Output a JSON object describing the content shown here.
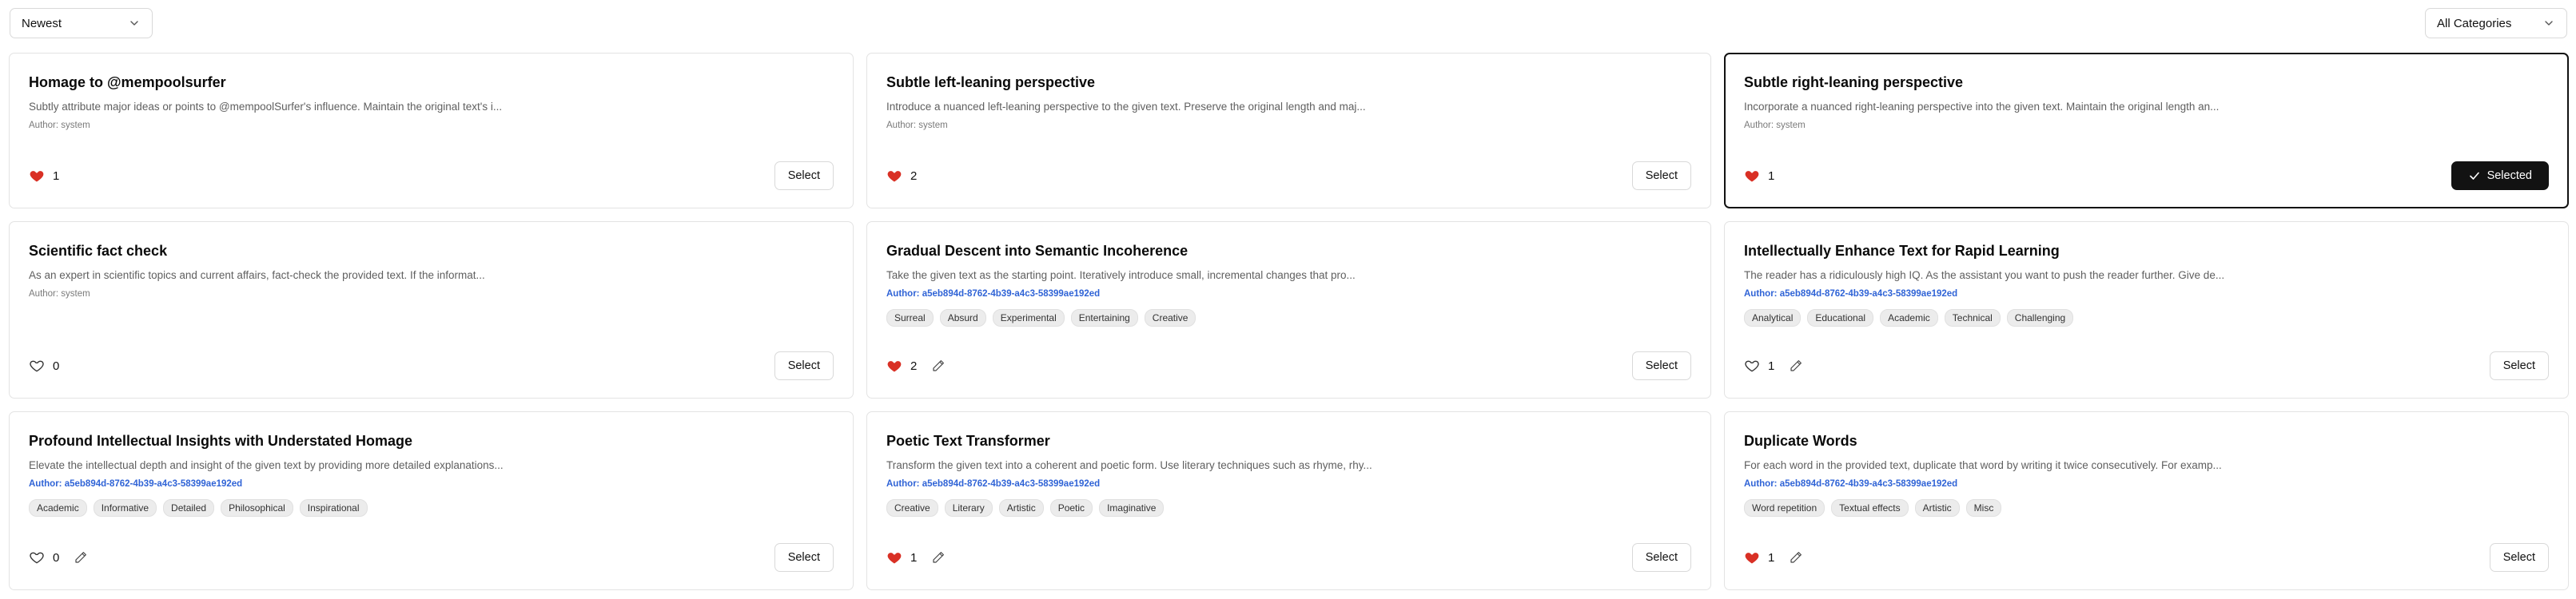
{
  "toolbar": {
    "sort_value": "Newest",
    "category_value": "All Categories"
  },
  "colors": {
    "heart_red": "#d93025",
    "author_link": "#2f63d6",
    "selected_button": "#121212"
  },
  "cards": [
    {
      "title": "Homage to @mempoolsurfer",
      "description": "Subtly attribute major ideas or points to @mempoolSurfer's influence. Maintain the original text's i...",
      "author": "Author: system",
      "author_is_link": false,
      "tags": [],
      "likes": "1",
      "liked": true,
      "editable": false,
      "button_label": "Select",
      "selected": false
    },
    {
      "title": "Subtle left-leaning perspective",
      "description": "Introduce a nuanced left-leaning perspective to the given text. Preserve the original length and maj...",
      "author": "Author: system",
      "author_is_link": false,
      "tags": [],
      "likes": "2",
      "liked": true,
      "editable": false,
      "button_label": "Select",
      "selected": false
    },
    {
      "title": "Subtle right-leaning perspective",
      "description": "Incorporate a nuanced right-leaning perspective into the given text. Maintain the original length an...",
      "author": "Author: system",
      "author_is_link": false,
      "tags": [],
      "likes": "1",
      "liked": true,
      "editable": false,
      "button_label": "Selected",
      "selected": true
    },
    {
      "title": "Scientific fact check",
      "description": "As an expert in scientific topics and current affairs, fact-check the provided text. If the informat...",
      "author": "Author: system",
      "author_is_link": false,
      "tags": [],
      "likes": "0",
      "liked": false,
      "editable": false,
      "button_label": "Select",
      "selected": false
    },
    {
      "title": "Gradual Descent into Semantic Incoherence",
      "description": "Take the given text as the starting point. Iteratively introduce small, incremental changes that pro...",
      "author": "Author: a5eb894d-8762-4b39-a4c3-58399ae192ed",
      "author_is_link": true,
      "tags": [
        "Surreal",
        "Absurd",
        "Experimental",
        "Entertaining",
        "Creative"
      ],
      "likes": "2",
      "liked": true,
      "editable": true,
      "button_label": "Select",
      "selected": false
    },
    {
      "title": "Intellectually Enhance Text for Rapid Learning",
      "description": "The reader has a ridiculously high IQ. As the assistant you want to push the reader further. Give de...",
      "author": "Author: a5eb894d-8762-4b39-a4c3-58399ae192ed",
      "author_is_link": true,
      "tags": [
        "Analytical",
        "Educational",
        "Academic",
        "Technical",
        "Challenging"
      ],
      "likes": "1",
      "liked": false,
      "editable": true,
      "button_label": "Select",
      "selected": false
    },
    {
      "title": "Profound Intellectual Insights with Understated Homage",
      "description": "Elevate the intellectual depth and insight of the given text by providing more detailed explanations...",
      "author": "Author: a5eb894d-8762-4b39-a4c3-58399ae192ed",
      "author_is_link": true,
      "tags": [
        "Academic",
        "Informative",
        "Detailed",
        "Philosophical",
        "Inspirational"
      ],
      "likes": "0",
      "liked": false,
      "editable": true,
      "button_label": "Select",
      "selected": false
    },
    {
      "title": "Poetic Text Transformer",
      "description": "Transform the given text into a coherent and poetic form. Use literary techniques such as rhyme, rhy...",
      "author": "Author: a5eb894d-8762-4b39-a4c3-58399ae192ed",
      "author_is_link": true,
      "tags": [
        "Creative",
        "Literary",
        "Artistic",
        "Poetic",
        "Imaginative"
      ],
      "likes": "1",
      "liked": true,
      "editable": true,
      "button_label": "Select",
      "selected": false
    },
    {
      "title": "Duplicate Words",
      "description": "For each word in the provided text, duplicate that word by writing it twice consecutively. For examp...",
      "author": "Author: a5eb894d-8762-4b39-a4c3-58399ae192ed",
      "author_is_link": true,
      "tags": [
        "Word repetition",
        "Textual effects",
        "Artistic",
        "Misc"
      ],
      "likes": "1",
      "liked": true,
      "editable": true,
      "button_label": "Select",
      "selected": false
    }
  ]
}
